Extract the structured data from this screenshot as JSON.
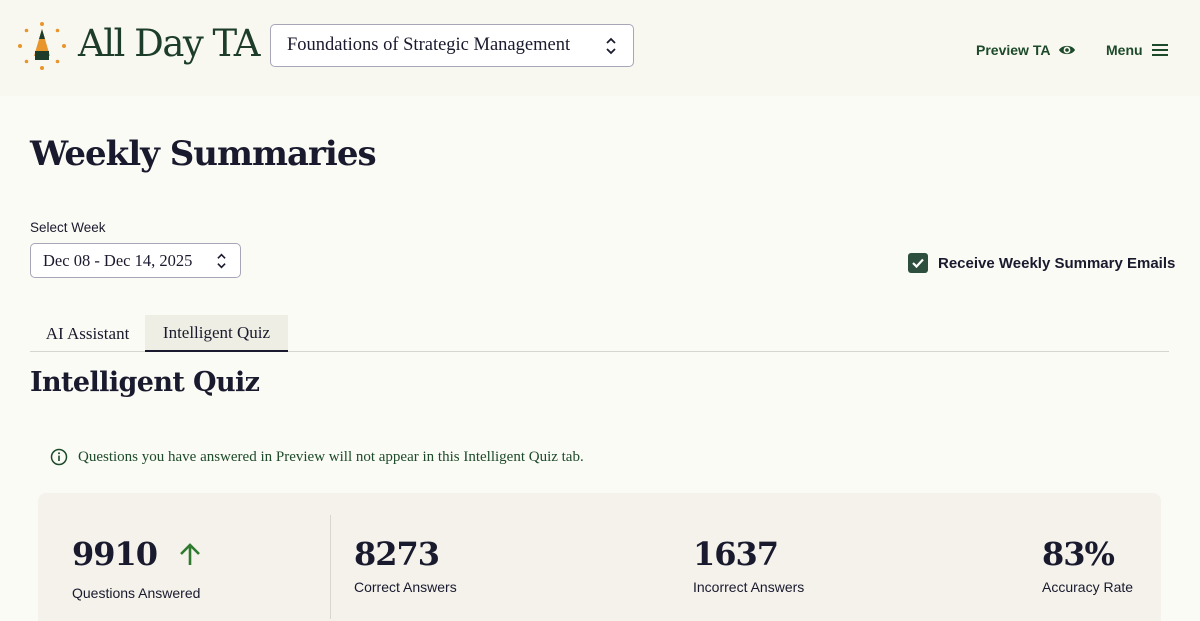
{
  "header": {
    "app_name": "All Day TA",
    "course_select": {
      "value": "Foundations of Strategic Management"
    },
    "preview_label": "Preview TA",
    "menu_label": "Menu"
  },
  "page": {
    "title": "Weekly Summaries",
    "week_label": "Select Week",
    "week_value": "Dec 08 - Dec 14, 2025",
    "email_option": {
      "label": "Receive Weekly Summary Emails",
      "checked": true
    }
  },
  "tabs": [
    {
      "label": "AI Assistant",
      "active": false
    },
    {
      "label": "Intelligent Quiz",
      "active": true
    }
  ],
  "section": {
    "title": "Intelligent Quiz",
    "notice": "Questions you have answered in Preview will not appear in this Intelligent Quiz tab."
  },
  "stats": [
    {
      "value": "9910",
      "label": "Questions Answered",
      "trend": "up"
    },
    {
      "value": "8273",
      "label": "Correct Answers"
    },
    {
      "value": "1637",
      "label": "Incorrect Answers"
    },
    {
      "value": "83%",
      "label": "Accuracy Rate"
    }
  ],
  "colors": {
    "brand_green": "#1d4a2a",
    "checkbox": "#2f4f3e",
    "logo_orange": "#e8962c",
    "background": "#fbfbf5"
  }
}
